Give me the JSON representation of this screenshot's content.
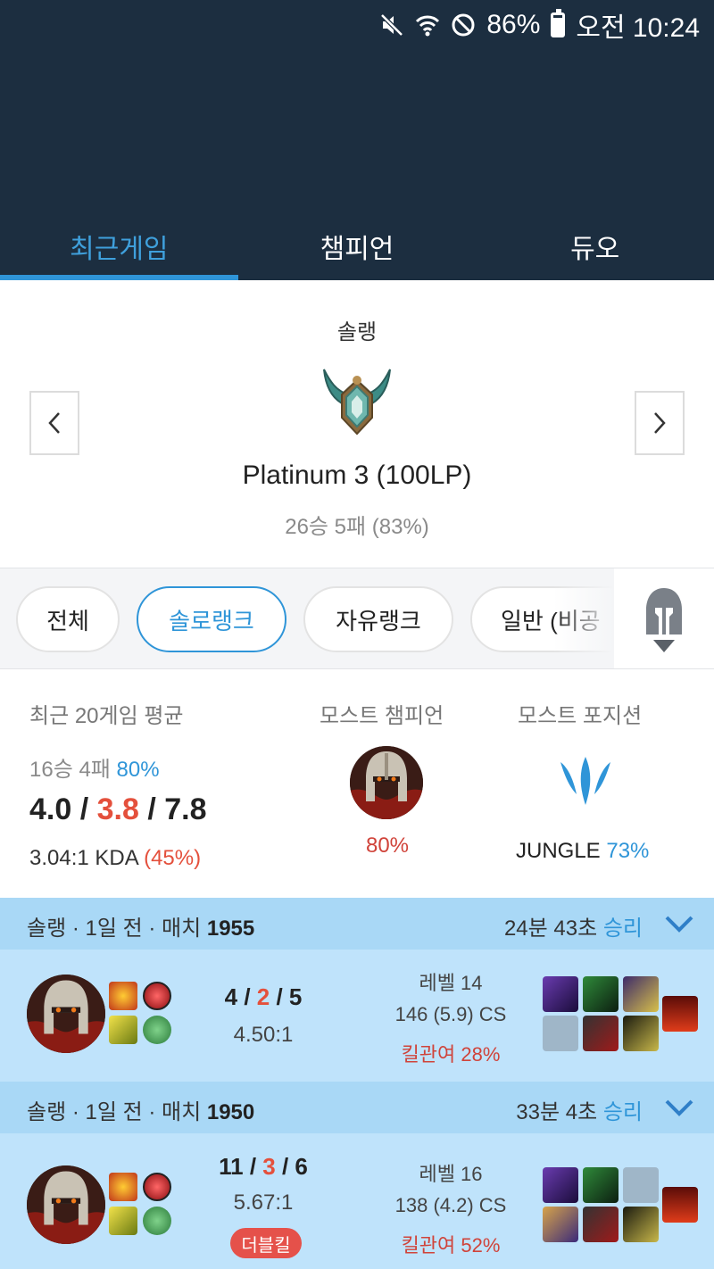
{
  "status_bar": {
    "battery": "86%",
    "time": "오전 10:24"
  },
  "tabs": [
    {
      "label": "최근게임",
      "active": true
    },
    {
      "label": "챔피언",
      "active": false
    },
    {
      "label": "듀오",
      "active": false
    }
  ],
  "rank": {
    "queue": "솔랭",
    "tier": "Platinum 3 (100LP)",
    "record": "26승 5패 (83%)"
  },
  "filters": [
    {
      "label": "전체",
      "active": false
    },
    {
      "label": "솔로랭크",
      "active": true
    },
    {
      "label": "자유랭크",
      "active": false
    },
    {
      "label": "일반 (비공",
      "active": false
    }
  ],
  "summary": {
    "recent_title": "최근 20게임 평균",
    "record": "16승 4패",
    "winrate": "80%",
    "kills": "4.0",
    "deaths": "3.8",
    "assists": "7.8",
    "kda_ratio": "3.04:1 KDA",
    "kill_participation": "(45%)",
    "most_champion_title": "모스트 챔피언",
    "most_champion_rate": "80%",
    "most_position_title": "모스트 포지션",
    "position": "JUNGLE",
    "position_rate": "73%"
  },
  "matches": [
    {
      "queue": "솔랭",
      "when": "1일 전",
      "match_label": "매치",
      "match_no": "1955",
      "duration": "24분 43초",
      "result": "승리",
      "kills": "4",
      "deaths": "2",
      "assists": "5",
      "ratio": "4.50:1",
      "level": "레벨 14",
      "cs": "146 (5.9) CS",
      "kp": "킬관여 28%",
      "badge": ""
    },
    {
      "queue": "솔랭",
      "when": "1일 전",
      "match_label": "매치",
      "match_no": "1950",
      "duration": "33분 4초",
      "result": "승리",
      "kills": "11",
      "deaths": "3",
      "assists": "6",
      "ratio": "5.67:1",
      "level": "레벨 16",
      "cs": "138 (4.2) CS",
      "kp": "킬관여 52%",
      "badge": "더블킬"
    }
  ],
  "colors": {
    "header_bg": "#1c2e40",
    "accent_blue": "#2f95d8",
    "death_red": "#e4503c",
    "win_head": "#a9d8f6",
    "win_body": "#bfe3fb"
  }
}
